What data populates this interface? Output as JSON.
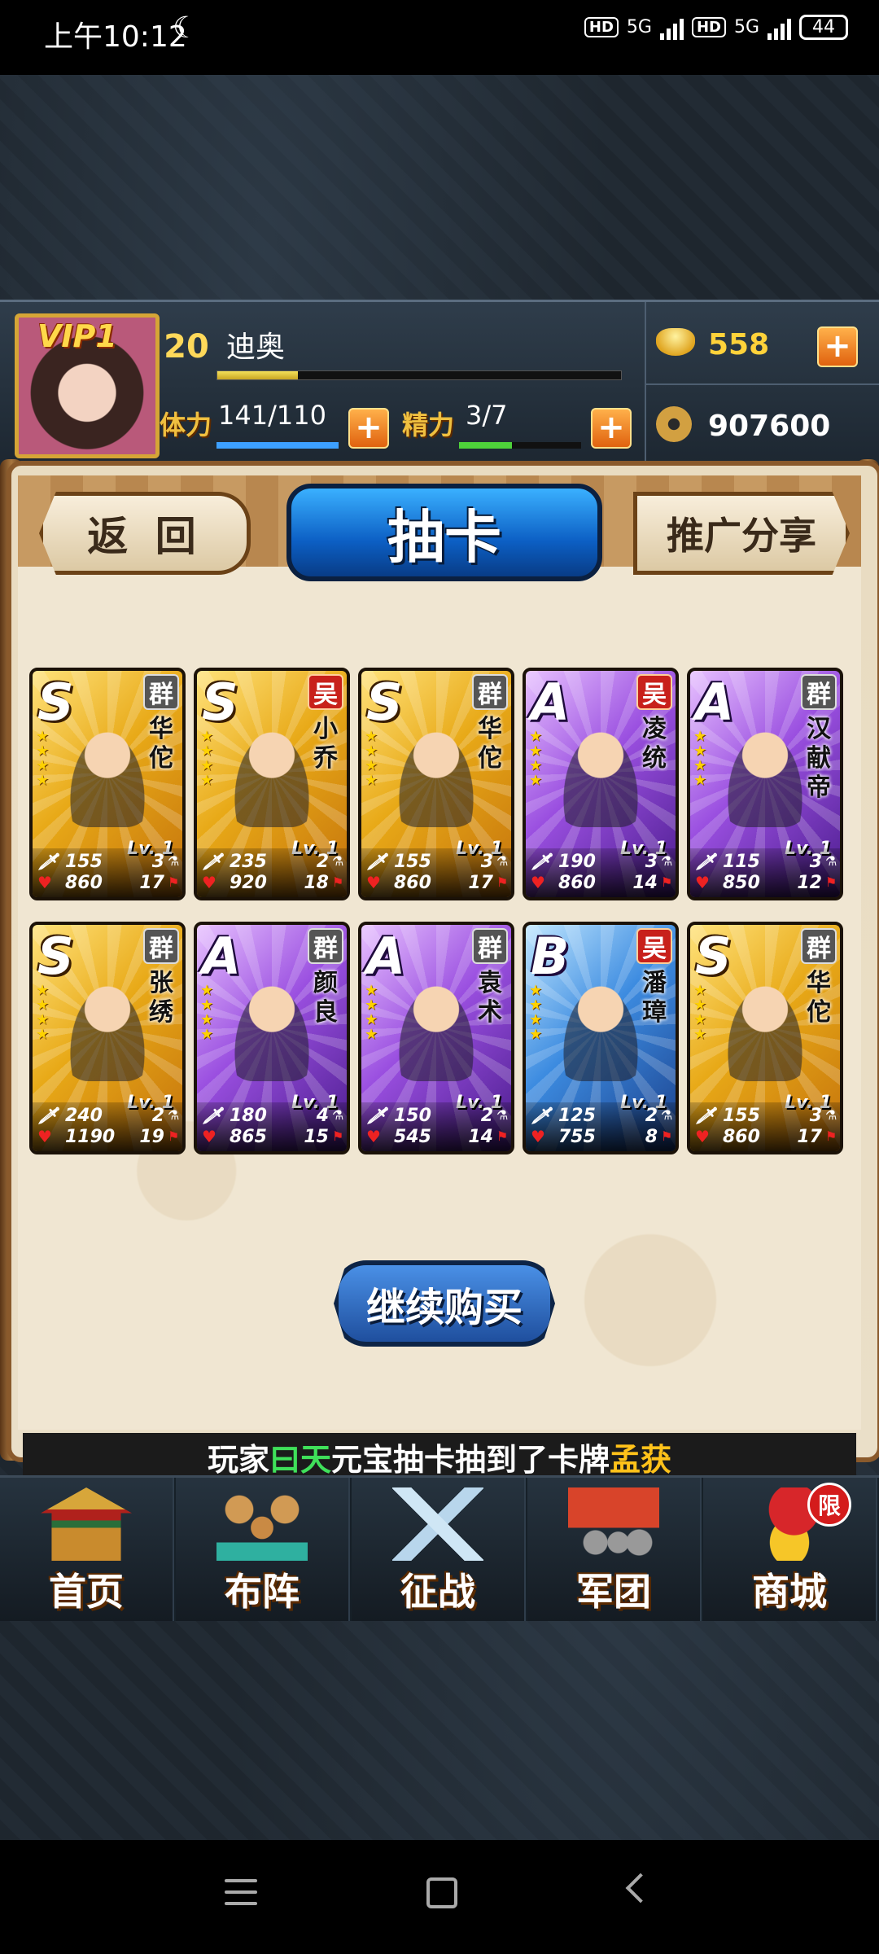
{
  "status_bar": {
    "time": "上午10:12",
    "moon_icon": "☾",
    "hd1": "HD",
    "net1": "5G",
    "hd2": "HD",
    "net2": "5G",
    "battery": "44"
  },
  "player": {
    "vip": "VIP1",
    "level": "20",
    "name": "迪奥",
    "exp_fraction": 0.2,
    "stamina_label": "体力",
    "stamina_value": "141/110",
    "stamina_fraction": 1.0,
    "energy_label": "精力",
    "energy_value": "3/7",
    "energy_fraction": 0.43,
    "plus": "+",
    "gold": "558",
    "coins": "907600"
  },
  "header": {
    "back_label": "返 回",
    "title": "抽卡",
    "share_label": "推广分享"
  },
  "cards": [
    {
      "grade": "S",
      "faction": "群",
      "faction_type": "qun",
      "name": "华佗",
      "level": "Lv. 1",
      "atk": "155",
      "atk_rank": "3",
      "hp": "860",
      "hp_rank": "17"
    },
    {
      "grade": "S",
      "faction": "吴",
      "faction_type": "wu",
      "name": "小乔",
      "level": "Lv. 1",
      "atk": "235",
      "atk_rank": "2",
      "hp": "920",
      "hp_rank": "18"
    },
    {
      "grade": "S",
      "faction": "群",
      "faction_type": "qun",
      "name": "华佗",
      "level": "Lv. 1",
      "atk": "155",
      "atk_rank": "3",
      "hp": "860",
      "hp_rank": "17"
    },
    {
      "grade": "A",
      "faction": "吴",
      "faction_type": "wu",
      "name": "凌统",
      "level": "Lv. 1",
      "atk": "190",
      "atk_rank": "3",
      "hp": "860",
      "hp_rank": "14"
    },
    {
      "grade": "A",
      "faction": "群",
      "faction_type": "qun",
      "name": "汉献帝",
      "level": "Lv. 1",
      "atk": "115",
      "atk_rank": "3",
      "hp": "850",
      "hp_rank": "12"
    },
    {
      "grade": "S",
      "faction": "群",
      "faction_type": "qun",
      "name": "张绣",
      "level": "Lv. 1",
      "atk": "240",
      "atk_rank": "2",
      "hp": "1190",
      "hp_rank": "19"
    },
    {
      "grade": "A",
      "faction": "群",
      "faction_type": "qun",
      "name": "颜良",
      "level": "Lv. 1",
      "atk": "180",
      "atk_rank": "4",
      "hp": "865",
      "hp_rank": "15"
    },
    {
      "grade": "A",
      "faction": "群",
      "faction_type": "qun",
      "name": "袁术",
      "level": "Lv. 1",
      "atk": "150",
      "atk_rank": "2",
      "hp": "545",
      "hp_rank": "14"
    },
    {
      "grade": "B",
      "faction": "吴",
      "faction_type": "wu",
      "name": "潘璋",
      "level": "Lv. 1",
      "atk": "125",
      "atk_rank": "2",
      "hp": "755",
      "hp_rank": "8"
    },
    {
      "grade": "S",
      "faction": "群",
      "faction_type": "qun",
      "name": "华佗",
      "level": "Lv. 1",
      "atk": "155",
      "atk_rank": "3",
      "hp": "860",
      "hp_rank": "17"
    }
  ],
  "continue_label": "继续购买",
  "marquee": {
    "prefix": "玩家",
    "player": "曰天",
    "middle": "元宝抽卡抽到了卡牌",
    "card": "孟获"
  },
  "nav": [
    {
      "label": "首页",
      "icon": "palace-icon"
    },
    {
      "label": "布阵",
      "icon": "chess-pieces-icon"
    },
    {
      "label": "征战",
      "icon": "crossed-swords-icon"
    },
    {
      "label": "军团",
      "icon": "army-banner-icon"
    },
    {
      "label": "商城",
      "icon": "treasure-bag-icon",
      "badge": "限"
    }
  ]
}
